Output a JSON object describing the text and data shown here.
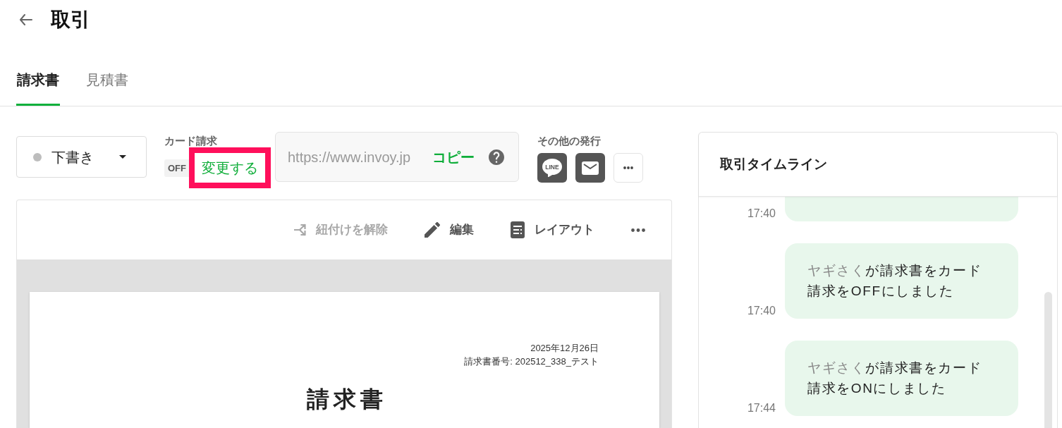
{
  "header": {
    "title": "取引"
  },
  "tabs": [
    {
      "label": "請求書",
      "selected": true
    },
    {
      "label": "見積書",
      "selected": false
    }
  ],
  "status_dropdown": {
    "value": "下書き"
  },
  "card_billing": {
    "label": "カード請求",
    "state": "OFF",
    "change_link": "変更する",
    "highlighted": true
  },
  "share_url": {
    "value": "https://www.invoy.jp",
    "copy": "コピー"
  },
  "other_issue": {
    "label": "その他の発行",
    "buttons": [
      {
        "kind": "line",
        "text": "LINE"
      },
      {
        "kind": "mail"
      },
      {
        "kind": "more"
      }
    ]
  },
  "toolbar": {
    "items": [
      {
        "kind": "unlink",
        "label": "紐付けを解除",
        "disabled": true
      },
      {
        "kind": "edit",
        "label": "編集",
        "disabled": false
      },
      {
        "kind": "layout",
        "label": "レイアウト",
        "disabled": false
      },
      {
        "kind": "more",
        "disabled": false
      }
    ]
  },
  "document": {
    "date": "2025年12月26日",
    "number": "請求書番号: 202512_338_テスト",
    "title": "請求書"
  },
  "timeline": {
    "title": "取引タイムライン",
    "entries": [
      {
        "time": "17:40"
      },
      {
        "time": "17:40",
        "actor": "ヤギさく",
        "text": "が請求書をカード請求をOFFにしました"
      },
      {
        "time": "17:44",
        "actor": "ヤギさく",
        "text": "が請求書をカード請求をONにしました"
      }
    ]
  }
}
